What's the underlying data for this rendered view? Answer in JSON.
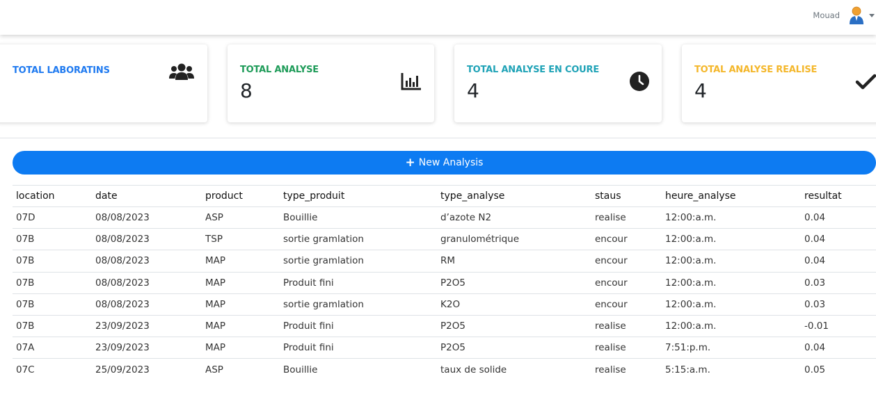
{
  "user": {
    "name": "Mouad"
  },
  "cards": [
    {
      "title": "TOTAL LABORATINS",
      "value": "",
      "color": "#1f7af0",
      "icon": "users-icon"
    },
    {
      "title": "TOTAL ANALYSE",
      "value": "8",
      "color": "#1d9b58",
      "icon": "chart-bar-icon"
    },
    {
      "title": "TOTAL ANALYSE EN COURE",
      "value": "4",
      "color": "#20a3b7",
      "icon": "clock-icon"
    },
    {
      "title": "TOTAL ANALYSE REALISE",
      "value": "4",
      "color": "#f4b72b",
      "icon": "check-icon"
    }
  ],
  "new_button": {
    "label": "New Analysis",
    "icon": "plus-icon"
  },
  "table": {
    "columns": [
      "location",
      "date",
      "product",
      "type_produit",
      "type_analyse",
      "staus",
      "heure_analyse",
      "resultat"
    ],
    "rows": [
      [
        "07D",
        "08/08/2023",
        "ASP",
        "Bouillie",
        "d’azote N2",
        "realise",
        "12:00:a.m.",
        "0.04"
      ],
      [
        "07B",
        "08/08/2023",
        "TSP",
        "sortie gramlation",
        "granulométrique",
        "encour",
        "12:00:a.m.",
        "0.04"
      ],
      [
        "07B",
        "08/08/2023",
        "MAP",
        "sortie gramlation",
        "RM",
        "encour",
        "12:00:a.m.",
        "0.04"
      ],
      [
        "07B",
        "08/08/2023",
        "MAP",
        "Produit fini",
        "P2O5",
        "encour",
        "12:00:a.m.",
        "0.03"
      ],
      [
        "07B",
        "08/08/2023",
        "MAP",
        "sortie gramlation",
        "K2O",
        "encour",
        "12:00:a.m.",
        "0.03"
      ],
      [
        "07B",
        "23/09/2023",
        "MAP",
        "Produit fini",
        "P2O5",
        "realise",
        "12:00:a.m.",
        "-0.01"
      ],
      [
        "07A",
        "23/09/2023",
        "MAP",
        "Produit fini",
        "P2O5",
        "realise",
        "7:51:p.m.",
        "0.04"
      ],
      [
        "07C",
        "25/09/2023",
        "ASP",
        "Bouillie",
        "taux de solide",
        "realise",
        "5:15:a.m.",
        "0.05"
      ]
    ]
  }
}
